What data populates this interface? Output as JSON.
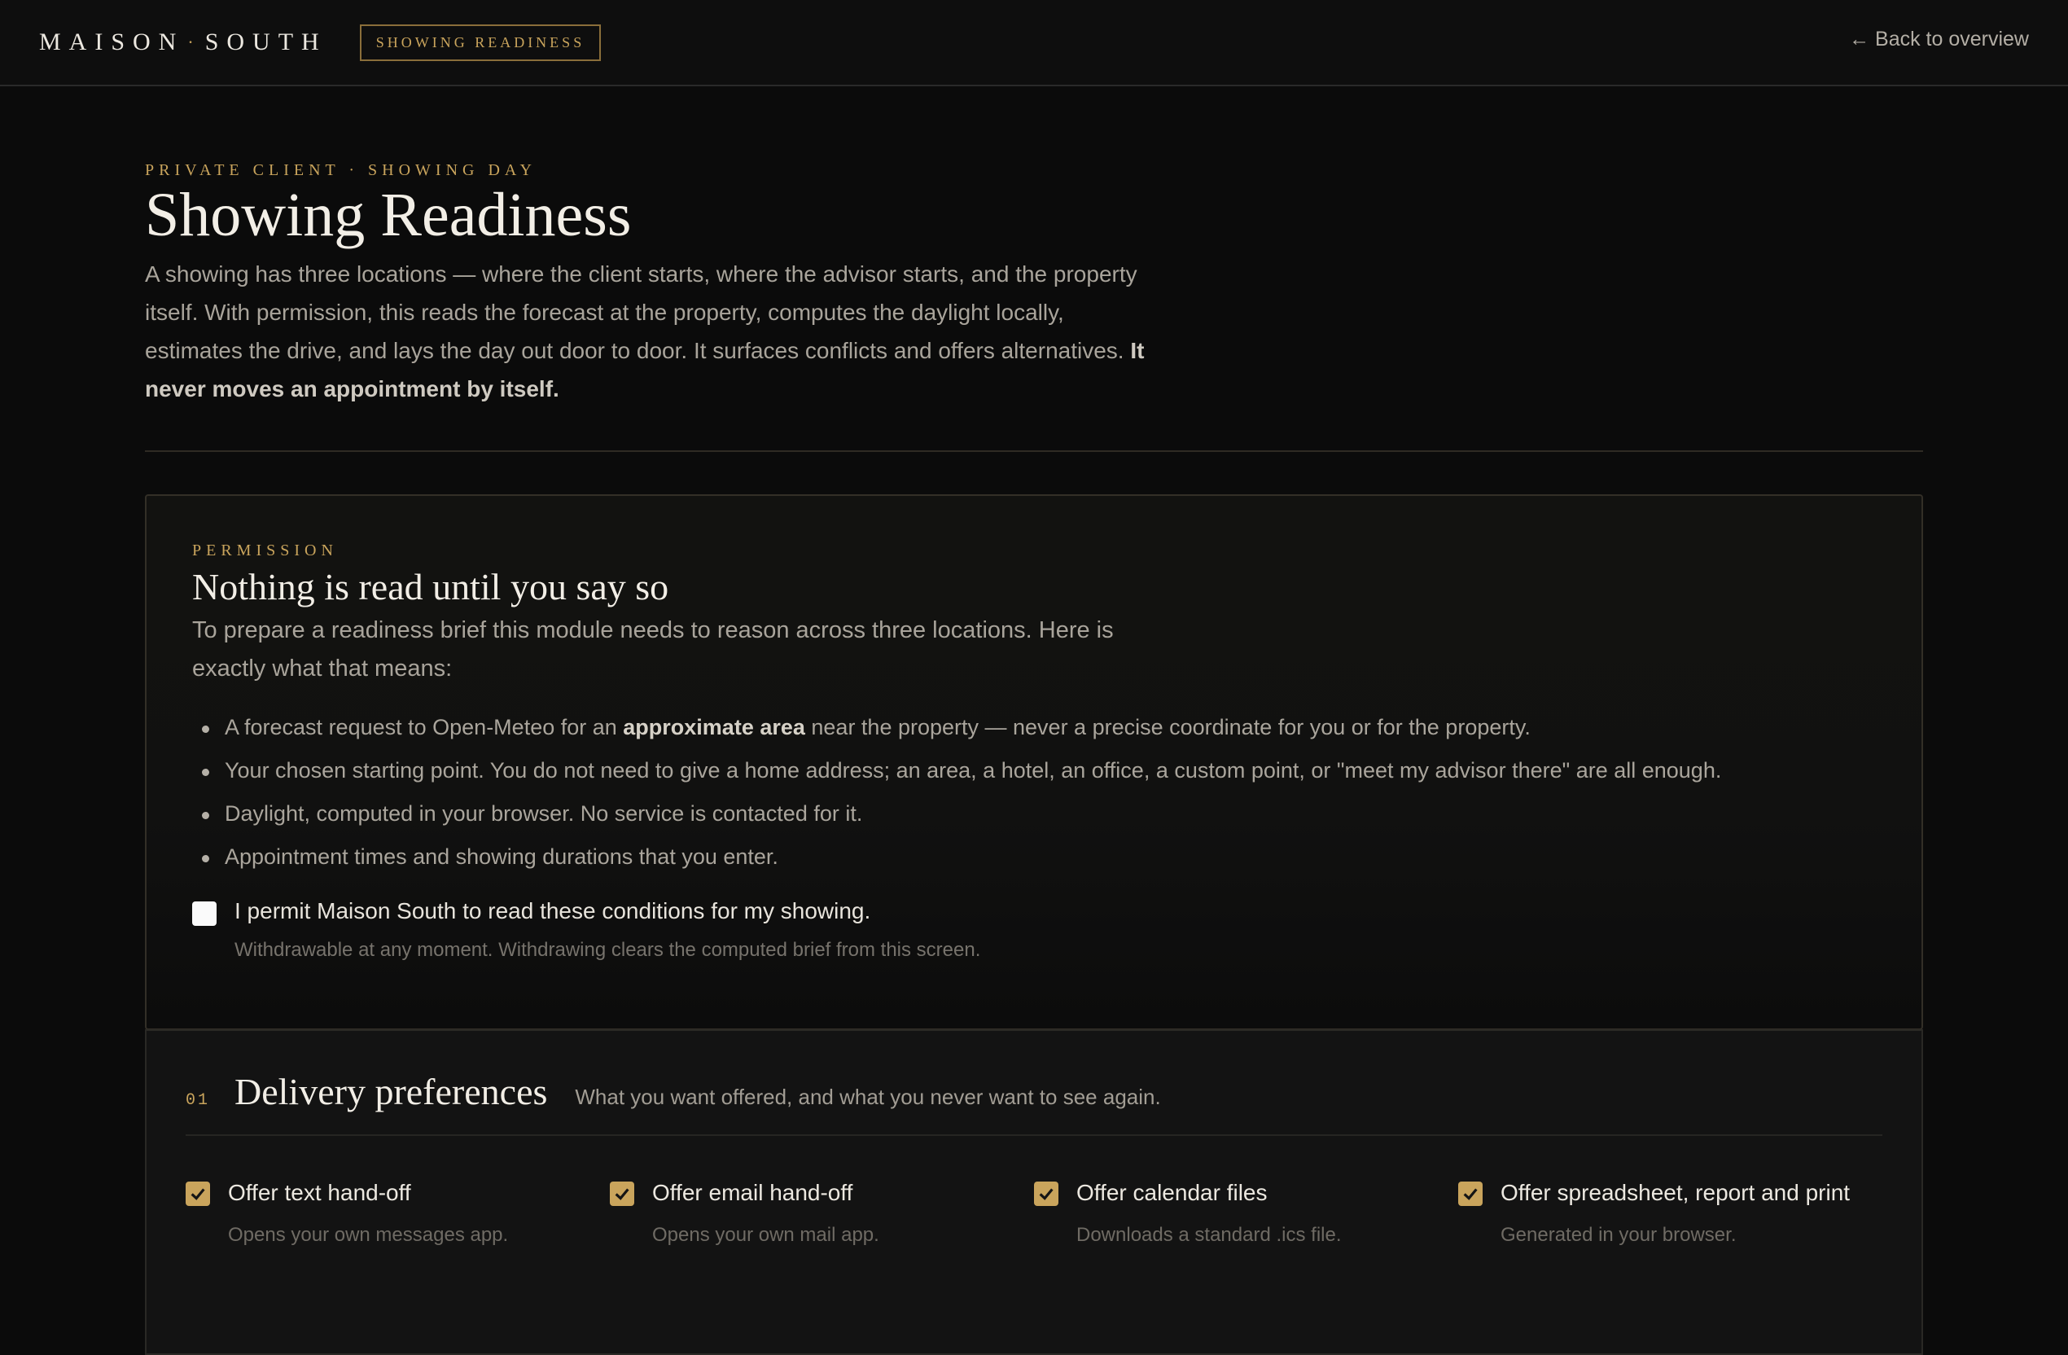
{
  "header": {
    "brand_left": "MAISON",
    "brand_dot": "·",
    "brand_right": "SOUTH",
    "badge": "SHOWING READINESS",
    "back_link": "← Back to overview"
  },
  "hero": {
    "eyebrow": "PRIVATE CLIENT · SHOWING DAY",
    "title": "Showing Readiness",
    "intro": "A showing has three locations — where the client starts, where the advisor starts, and the property itself. With permission, this reads the forecast at the property, computes the daylight locally, estimates the drive, and lays the day out door to door. It surfaces conflicts and offers alternatives.",
    "intro_strong": "It never moves an appointment by itself."
  },
  "permission": {
    "eyebrow": "PERMISSION",
    "title": "Nothing is read until you say so",
    "description": "To prepare a readiness brief this module needs to reason across three locations. Here is exactly what that means:",
    "bullets": [
      {
        "pre": "A forecast request to Open-Meteo for an ",
        "strong": "approximate area",
        "post": " near the property — never a precise coordinate for you or for the property."
      },
      {
        "pre": "Your chosen starting point. You do not need to give a home address; an area, a hotel, an office, a custom point, or \"meet my advisor there\" are all enough.",
        "strong": "",
        "post": ""
      },
      {
        "pre": "Daylight, computed in your browser. No service is contacted for it.",
        "strong": "",
        "post": ""
      },
      {
        "pre": "Appointment times and showing durations that you enter.",
        "strong": "",
        "post": ""
      }
    ],
    "consent_label": "I permit Maison South to read these conditions for my showing.",
    "consent_hint": "Withdrawable at any moment. Withdrawing clears the computed brief from this screen.",
    "consent_checked": false
  },
  "delivery": {
    "number": "01",
    "title": "Delivery preferences",
    "subtitle": "What you want offered, and what you never want to see again.",
    "options": [
      {
        "label": "Offer text hand-off",
        "hint": "Opens your own messages app.",
        "checked": true
      },
      {
        "label": "Offer email hand-off",
        "hint": "Opens your own mail app.",
        "checked": true
      },
      {
        "label": "Offer calendar files",
        "hint": "Downloads a standard .ics file.",
        "checked": true
      },
      {
        "label": "Offer spreadsheet, report and print",
        "hint": "Generated in your browser.",
        "checked": true
      }
    ]
  },
  "colors": {
    "accent": "#c9a45c",
    "background": "#0b0b0b",
    "card": "#121210"
  }
}
